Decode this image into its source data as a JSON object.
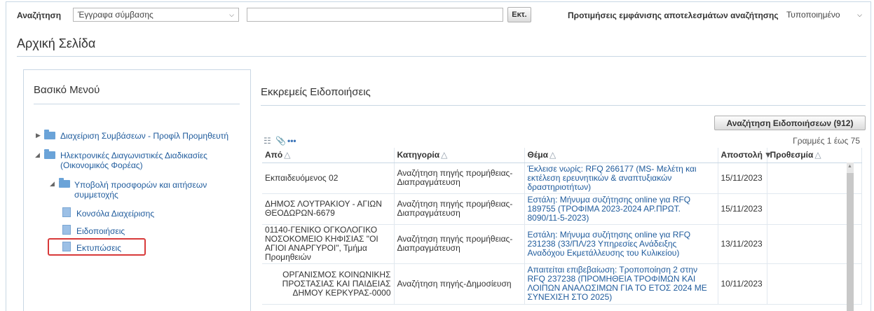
{
  "search": {
    "label": "Αναζήτηση",
    "type_selected": "Έγγραφα σύμβασης",
    "query_value": "",
    "go_label": "Εκτ.",
    "prefs_label": "Προτιμήσεις εμφάνισης αποτελεσμάτων αναζήτησης",
    "prefs_selected": "Τυποποιημένο"
  },
  "page": {
    "title": "Αρχική Σελίδα"
  },
  "menu": {
    "title": "Βασικό Μενού",
    "items": [
      {
        "label": "Διαχείριση Συμβάσεων - Προφίλ Προμηθευτή",
        "kind": "folder",
        "expanded": false
      },
      {
        "label": "Ηλεκτρονικές Διαγωνιστικές Διαδικασίες (Οικονομικός Φορέας)",
        "kind": "folder",
        "expanded": true
      },
      {
        "label": "Υποβολή προσφορών και αιτήσεων συμμετοχής",
        "kind": "folder",
        "expanded": true
      },
      {
        "label": "Κονσόλα Διαχείρισης",
        "kind": "page"
      },
      {
        "label": "Ειδοποιήσεις",
        "kind": "page"
      },
      {
        "label": "Εκτυπώσεις",
        "kind": "page",
        "highlighted": true
      }
    ]
  },
  "notifications": {
    "title": "Εκκρεμείς Ειδοποιήσεις",
    "search_button": "Αναζήτηση Ειδοποιήσεων (912)",
    "rows_info": "Γραμμές 1 έως 75",
    "columns": [
      "Από",
      "Κατηγορία",
      "Θέμα",
      "Αποστολή",
      "Προθεσμία"
    ],
    "rows": [
      {
        "from": "Εκπαιδευόμενος 02",
        "category": "Αναζήτηση πηγής προμήθειας-Διαπραγμάτευση",
        "subject": "Έκλεισε νωρίς: RFQ 266177 (MS- Μελέτη και εκτέλεση ερευνητικών & αναπτυξιακών δραστηριοτήτων)",
        "sent": "15/11/2023",
        "deadline": ""
      },
      {
        "from": "ΔΗΜΟΣ ΛΟΥΤΡΑΚΙΟΥ - ΑΓΙΩΝ ΘΕΟΔΩΡΩΝ-6679",
        "category": "Αναζήτηση πηγής προμήθειας-Διαπραγμάτευση",
        "subject": "Εστάλη: Μήνυμα συζήτησης online για RFQ 189755 (ΤΡΟΦΙΜΑ 2023-2024 ΑΡ.ΠΡΩΤ. 8090/11-5-2023)",
        "sent": "15/11/2023",
        "deadline": ""
      },
      {
        "from": "01140-ΓΕΝΙΚΟ ΟΓΚΟΛΟΓΙΚΟ ΝΟΣΟΚΟΜΕΙΟ ΚΗΦΙΣΙΑΣ \"ΟΙ ΑΓΙΟΙ ΑΝΑΡΓΥΡΟΙ\", Τμήμα Προμηθειών",
        "category": "Αναζήτηση πηγής προμήθειας-Διαπραγμάτευση",
        "subject": "Εστάλη: Μήνυμα συζήτησης online για RFQ 231238 (33/ΠΛ/23 Υπηρεσίες Ανάδειξης Αναδόχου Εκμετάλλευσης του Κυλικείου)",
        "sent": "13/11/2023",
        "deadline": ""
      },
      {
        "from": "ΟΡΓΑΝΙΣΜΟΣ ΚΟΙΝΩΝΙΚΗΣ ΠΡΟΣΤΑΣΙΑΣ ΚΑΙ ΠΑΙΔΕΙΑΣ ΔΗΜΟΥ ΚΕΡΚΥΡΑΣ-0000",
        "category": "Αναζήτηση πηγής-Δημοσίευση",
        "subject": "Απαιτείται επιβεβαίωση: Τροποποίηση 2 στην RFQ 237238 (ΠΡΟΜΗΘΕΙΑ ΤΡΟΦΙΜΩΝ ΚΑΙ ΛΟΙΠΩΝ ΑΝΑΛΩΣΙΜΩΝ ΓΙΑ ΤΟ ΕΤΟΣ 2024 ΜΕ ΣΥΝΕΧΙΣΗ ΣΤΟ 2025)",
        "sent": "10/11/2023",
        "deadline": ""
      }
    ]
  }
}
